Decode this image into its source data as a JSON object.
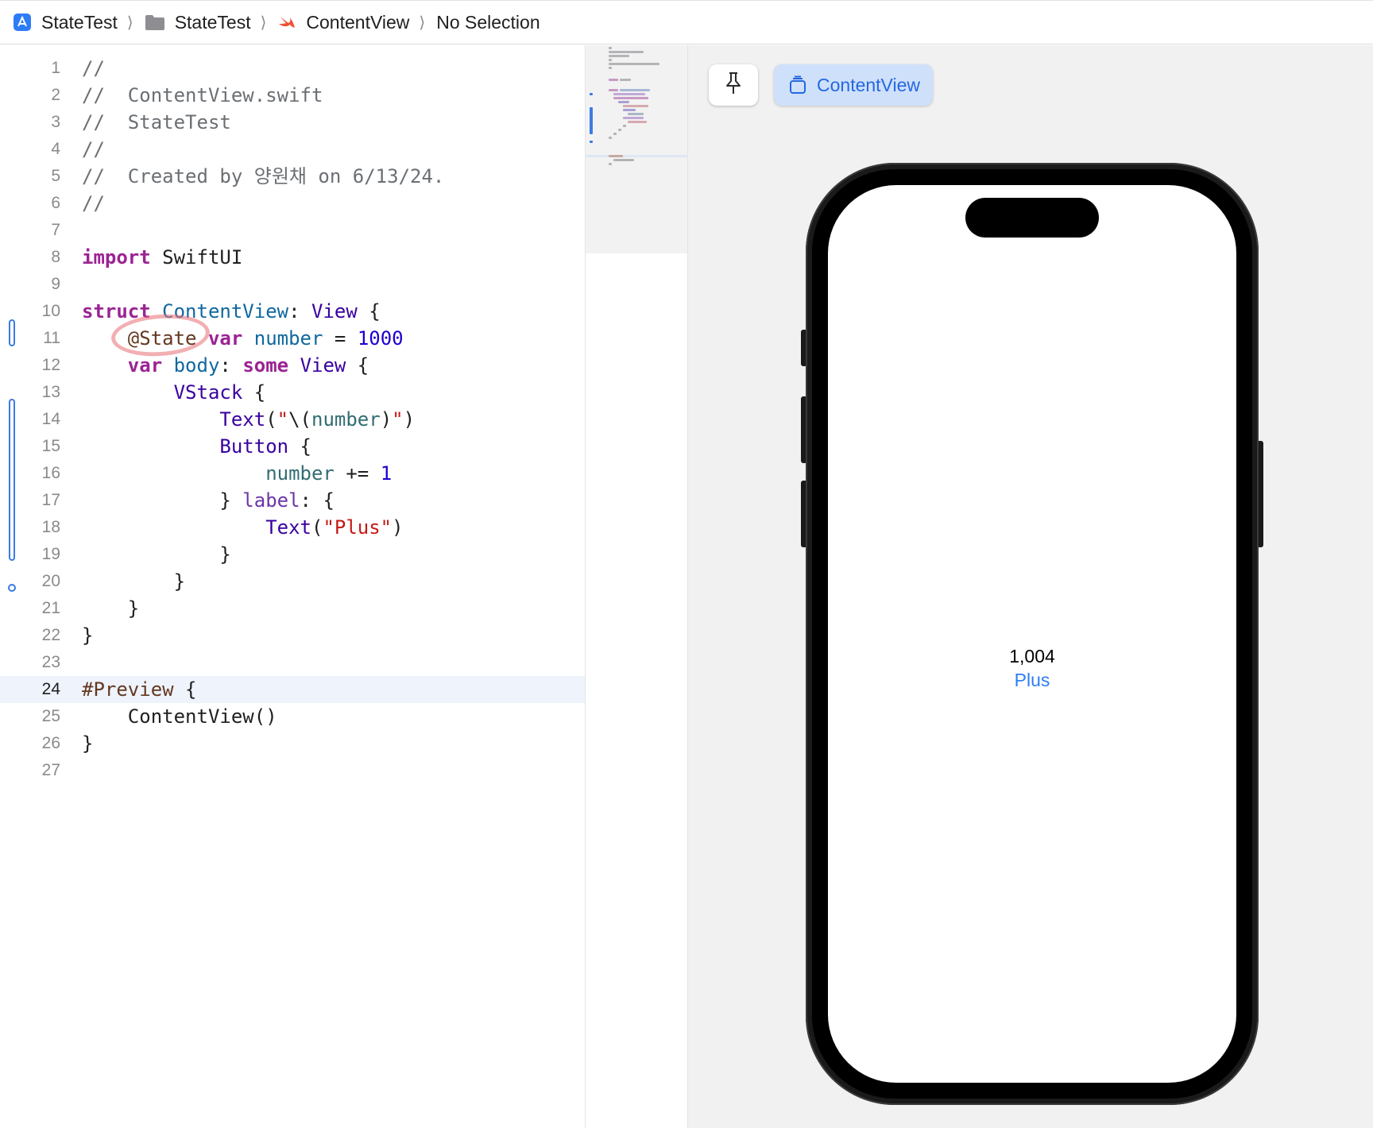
{
  "breadcrumb": {
    "items": [
      {
        "label": "StateTest",
        "icon": "app-icon"
      },
      {
        "label": "StateTest",
        "icon": "folder-icon"
      },
      {
        "label": "ContentView",
        "icon": "swift-icon"
      },
      {
        "label": "No Selection",
        "icon": ""
      }
    ],
    "separator": "⟩"
  },
  "editor": {
    "current_line": 24,
    "lines": [
      {
        "n": "1"
      },
      {
        "n": "2"
      },
      {
        "n": "3"
      },
      {
        "n": "4"
      },
      {
        "n": "5"
      },
      {
        "n": "6"
      },
      {
        "n": "7"
      },
      {
        "n": "8"
      },
      {
        "n": "9"
      },
      {
        "n": "10"
      },
      {
        "n": "11"
      },
      {
        "n": "12"
      },
      {
        "n": "13"
      },
      {
        "n": "14"
      },
      {
        "n": "15"
      },
      {
        "n": "16"
      },
      {
        "n": "17"
      },
      {
        "n": "18"
      },
      {
        "n": "19"
      },
      {
        "n": "20"
      },
      {
        "n": "21"
      },
      {
        "n": "22"
      },
      {
        "n": "23"
      },
      {
        "n": "24"
      },
      {
        "n": "25"
      },
      {
        "n": "26"
      },
      {
        "n": "27"
      }
    ],
    "tokens": {
      "l1": "//",
      "l2": "//  ContentView.swift",
      "l3": "//  StateTest",
      "l4": "//",
      "l5": "//  Created by 양원채 on 6/13/24.",
      "l6": "//",
      "l8_kw": "import",
      "l8_rest": " SwiftUI",
      "l10_kw": "struct",
      "l10_name": " ContentView",
      "l10_colon": ": ",
      "l10_type": "View",
      "l10_brace": " {",
      "l11_indent": "    ",
      "l11_attr": "@State",
      "l11_sp": " ",
      "l11_kw": "var",
      "l11_name": " number",
      "l11_eq": " = ",
      "l11_num": "1000",
      "l12_indent": "    ",
      "l12_kw": "var",
      "l12_name": " body",
      "l12_colon": ": ",
      "l12_kw2": "some",
      "l12_sp": " ",
      "l12_type": "View",
      "l12_brace": " {",
      "l13_indent": "        ",
      "l13_type": "VStack",
      "l13_brace": " {",
      "l14_indent": "            ",
      "l14_type": "Text",
      "l14_p1": "(",
      "l14_s1": "\"",
      "l14_interp": "\\(",
      "l14_prop": "number",
      "l14_interp2": ")",
      "l14_s2": "\"",
      "l14_p2": ")",
      "l15_indent": "            ",
      "l15_type": "Button",
      "l15_brace": " {",
      "l16_indent": "                ",
      "l16_prop": "number",
      "l16_op": " += ",
      "l16_num": "1",
      "l17_indent": "            ",
      "l17_brace": "} ",
      "l17_label": "label",
      "l17_rest": ": {",
      "l18_indent": "                ",
      "l18_type": "Text",
      "l18_p1": "(",
      "l18_str": "\"Plus\"",
      "l18_p2": ")",
      "l19": "            }",
      "l20": "        }",
      "l21": "    }",
      "l22": "}",
      "l24_macro": "#Preview",
      "l24_brace": " {",
      "l25_indent": "    ",
      "l25_call": "ContentView()",
      "l26": "}"
    }
  },
  "preview": {
    "tab_label": "ContentView",
    "pin_icon": "pin-icon",
    "device_text": "1,004",
    "device_button": "Plus"
  },
  "colors": {
    "keyword": "#9b2393",
    "type": "#3900a0",
    "number": "#1c00cf",
    "string": "#c41a16",
    "comment": "#6b6f73",
    "accent": "#2f7df6",
    "annotation_circle": "#e86e73"
  }
}
